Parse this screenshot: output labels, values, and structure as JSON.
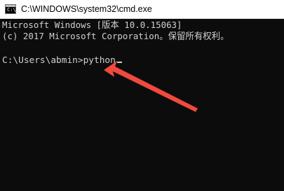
{
  "window": {
    "title": "C:\\WINDOWS\\system32\\cmd.exe",
    "icon_label": "C:\\"
  },
  "console": {
    "line1": "Microsoft Windows [版本 10.0.15063]",
    "line2": "(c) 2017 Microsoft Corporation。保留所有权利。",
    "prompt": "C:\\Users\\abmin>",
    "command": "python"
  },
  "annotation": {
    "arrow_color": "#f04a3e"
  }
}
